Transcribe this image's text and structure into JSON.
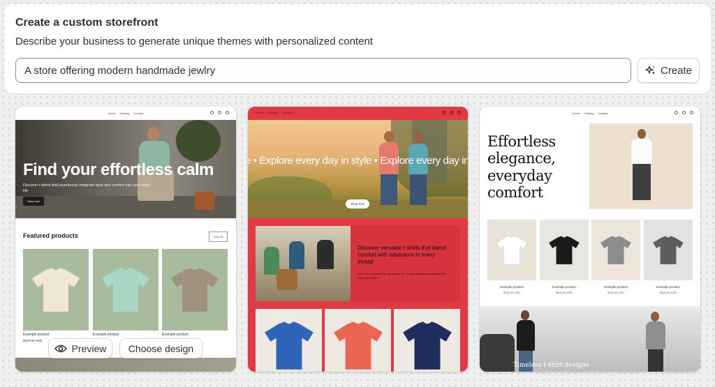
{
  "header": {
    "title": "Create a custom storefront",
    "subtitle": "Describe your business to generate unique themes with personalized content",
    "prompt_value": "A store offering modern handmade jewlry",
    "create_label": "Create",
    "create_icon": "sparkle-icon"
  },
  "card_actions": {
    "preview_label": "Preview",
    "preview_icon": "eye-icon",
    "choose_label": "Choose design"
  },
  "theme1": {
    "nav": [
      "Home",
      "Catalog",
      "Contact"
    ],
    "hero_title": "Find your effortless calm",
    "hero_desc": "Discover t-shirts that seamlessly integrate style and comfort into your daily life",
    "hero_cta": "Shop now",
    "featured_title": "Featured products",
    "view_all": "View all",
    "products": [
      {
        "name": "Example product",
        "price": "$100.00 USD",
        "color": "#efe6d6"
      },
      {
        "name": "Example product",
        "price": "$100.00 USD",
        "color": "#a8d8c5"
      },
      {
        "name": "Example product",
        "price": "$100.00 USD",
        "color": "#a0927e"
      }
    ]
  },
  "theme2": {
    "nav": [
      "Home",
      "Catalog",
      "Contact"
    ],
    "marquee": "e  •  Explore every day in style  •  Explore every day in style",
    "hero_cta": "Shop now",
    "feature_title": "Discover versatile t-shirts that blend comfort with adventure in every thread",
    "feature_desc": "Born from a passion for adventure, we create t-shirts that celebrate life's everyday stories.",
    "tees": [
      "#2f64b8",
      "#ea6552",
      "#1f2d5c"
    ]
  },
  "theme3": {
    "nav": [
      "Home",
      "Catalog",
      "Contact"
    ],
    "hero_title_lines": [
      "Effortless",
      "elegance,",
      "everyday",
      "comfort"
    ],
    "products": [
      {
        "name": "Example product",
        "price": "$100.00 USD",
        "bg": "#e9e2d7",
        "tee": "#ffffff"
      },
      {
        "name": "Example product",
        "price": "$100.00 USD",
        "bg": "#e8e6e1",
        "tee": "#1a1a1a"
      },
      {
        "name": "Example product",
        "price": "$100.00 USD",
        "bg": "#ece5da",
        "tee": "#8c8c8c"
      },
      {
        "name": "Example product",
        "price": "$100.00 USD",
        "bg": "#e3e3e3",
        "tee": "#5e5e5e"
      }
    ],
    "bottom_caption": "Timeless t-shirt designs"
  }
}
